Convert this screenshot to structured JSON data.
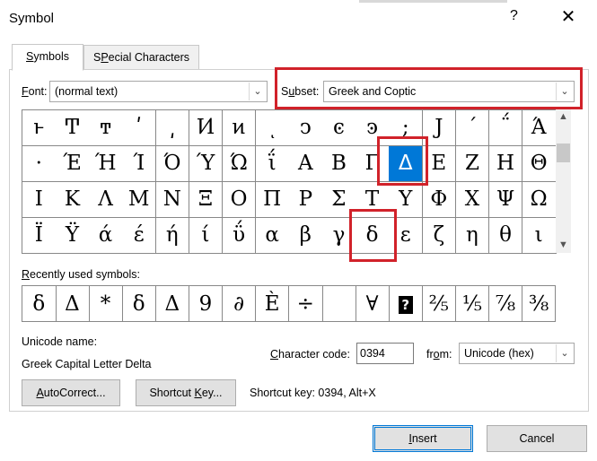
{
  "window": {
    "title": "Symbol",
    "help_glyph": "?",
    "close_glyph": "✕"
  },
  "tabs": [
    {
      "label": "Symbols",
      "accel": "S",
      "rest": "ymbols",
      "active": true
    },
    {
      "label": "Special Characters",
      "accel": "P",
      "pre": "S",
      "rest": "ecial Characters",
      "active": false
    }
  ],
  "font": {
    "label_pre": "",
    "label_accel": "F",
    "label_rest": "ont:",
    "value": "(normal text)"
  },
  "subset": {
    "label_accel": "u",
    "label_pre": "S",
    "label_rest": "bset:",
    "value": "Greek and Coptic"
  },
  "icons": {
    "dropdown_arrow": "chevron-down-icon",
    "scroll_up": "scroll-up-icon",
    "scroll_down": "scroll-down-icon"
  },
  "symbol_grid": {
    "rows": [
      [
        "ͱ",
        "Ͳ",
        "ͳ",
        "ʹ",
        "͵",
        "Ͷ",
        "ͷ",
        "ͺ",
        "ͻ",
        "ͼ",
        "ͽ",
        ";",
        "Ϳ",
        "΄",
        "΅",
        "Ά"
      ],
      [
        "·",
        "Έ",
        "Ή",
        "Ί",
        "Ό",
        "Ύ",
        "Ώ",
        "ΐ",
        "Α",
        "Β",
        "Γ",
        "Δ",
        "Ε",
        "Ζ",
        "Η",
        "Θ"
      ],
      [
        "Ι",
        "Κ",
        "Λ",
        "Μ",
        "Ν",
        "Ξ",
        "Ο",
        "Π",
        "Ρ",
        "Σ",
        "Τ",
        "Υ",
        "Φ",
        "Χ",
        "Ψ",
        "Ω"
      ],
      [
        "Ϊ",
        "Ϋ",
        "ά",
        "έ",
        "ή",
        "ί",
        "ΰ",
        "α",
        "β",
        "γ",
        "δ",
        "ε",
        "ζ",
        "η",
        "θ",
        "ι"
      ]
    ],
    "selected": "Δ"
  },
  "recent": {
    "label_accel": "R",
    "label_rest": "ecently used symbols:",
    "symbols": [
      "δ",
      "Δ",
      "*",
      "δ",
      "Δ",
      "9",
      "∂",
      "È",
      "÷",
      "",
      "∀",
      "?",
      "⅖",
      "⅕",
      "⅞",
      "⅜"
    ]
  },
  "unicode_name": {
    "label": "Unicode name:",
    "value": "Greek Capital Letter Delta"
  },
  "character_code": {
    "label_accel": "C",
    "label_rest": "haracter code:",
    "value": "0394"
  },
  "from": {
    "label_pre": "fr",
    "label_accel": "o",
    "label_rest": "m:",
    "value": "Unicode (hex)"
  },
  "buttons": {
    "autocorrect": {
      "accel": "A",
      "rest": "utoCorrect..."
    },
    "shortcut_key": {
      "pre": "Shortcut ",
      "accel": "K",
      "rest": "ey..."
    },
    "insert": {
      "accel": "I",
      "rest": "nsert"
    },
    "cancel": "Cancel"
  },
  "shortcut_key_text": "Shortcut key: 0394, Alt+X",
  "highlight_color": "#d1222a",
  "selection_color": "#0078d7"
}
